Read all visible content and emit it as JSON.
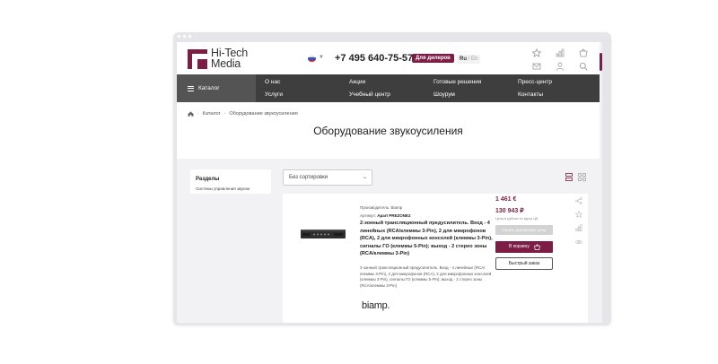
{
  "header": {
    "logo_line1": "Hi-Tech",
    "logo_line2": "Media",
    "phone": "+7 495 640-75-57",
    "dealers_label": "Для дилеров",
    "lang_active": "Ru",
    "lang_separator": " / ",
    "lang_other": "En"
  },
  "nav": {
    "catalog_label": "Каталог",
    "links": [
      "О нас",
      "Акции",
      "Готовые решения",
      "Пресс-центр",
      "Услуги",
      "Учебный центр",
      "Шоурум",
      "Контакты"
    ]
  },
  "breadcrumb": {
    "items": [
      "Каталог",
      "Оборудование звукоусиления"
    ],
    "separator": "›"
  },
  "page_title": "Оборудование звукоусиления",
  "sidebar": {
    "title": "Разделы",
    "items": [
      "Системы управления звуком"
    ]
  },
  "sort": {
    "selected": "Без сортировки"
  },
  "product": {
    "manufacturer": "Производитель: Biamp",
    "article_label": "Артикул: ",
    "article": "Apart PREZONE2",
    "name": "2-зонный трансляционный предусилитель. Вход - 4 линейных (RCA/клеммы 3-Pin), 2 для микрофонов (RCA), 2 для микрофонных консолей (клеммы 3-Pin), сигналы ГО (клеммы 5-Pin); выход - 2 стерео зоны (RCA/клеммы 3-Pin)",
    "description": "2-зонный трансляционный предусилитель. Вход - 4 линейных (RCA/клеммы 3-Pin), 2 для микрофонов (RCA), 2 для микрофонных консолей (клеммы 3-Pin), сигналы ГО (клеммы 5-Pin); выход - 2 стерео зоны (RCA/клеммы 3-Pin)",
    "brand": "biamp.",
    "price_eur": "1 461 €",
    "price_rub": "130 943 ₽",
    "price_note": "Цена в рублях по курсу ЦБ",
    "dealer_price_label": "Узнать дилерскую цену",
    "cart_label": "В корзину",
    "quick_order_label": "Быстрый заказ"
  },
  "colors": {
    "brand": "#7b1d45",
    "nav_bg": "#3e3e3e",
    "catalog_bg": "#545454"
  },
  "icons": {
    "header": [
      "star-icon",
      "compare-icon",
      "basket-icon",
      "mail-icon",
      "user-icon",
      "search-icon"
    ],
    "card": [
      "share-icon",
      "favorite-icon",
      "compare-icon",
      "view-icon"
    ]
  }
}
